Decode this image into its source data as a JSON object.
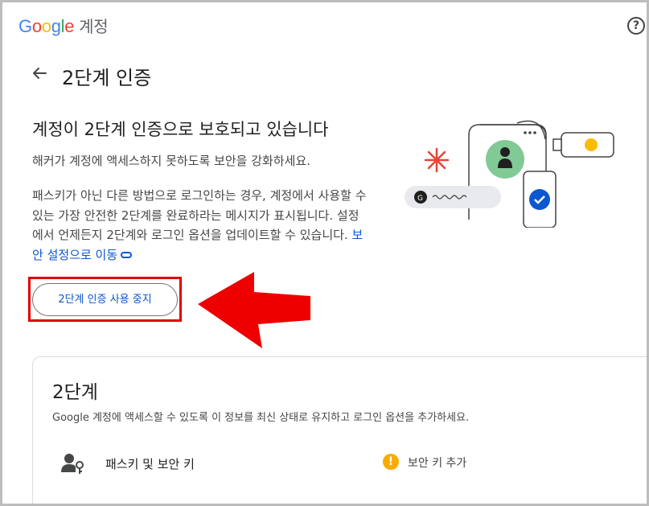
{
  "header": {
    "brand": {
      "g1": "G",
      "o1": "o",
      "o2": "o",
      "g2": "g",
      "l": "l",
      "e": "e",
      "account": "계정"
    },
    "help_icon": "?"
  },
  "page": {
    "title": "2단계 인증",
    "headline": "계정이 2단계 인증으로 보호되고 있습니다",
    "subtext": "해커가 계정에 액세스하지 못하도록 보안을 강화하세요.",
    "paragraph": "패스키가 아닌 다른 방법으로 로그인하는 경우, 계정에서 사용할 수 있는 가장 안전한 2단계를 완료하라는 메시지가 표시됩니다. 설정에서 언제든지 2단계와 로그인 옵션을 업데이트할 수 있습니다.",
    "security_link": "보안 설정으로 이동",
    "stop_button": "2단계 인증 사용 중지"
  },
  "card": {
    "title": "2단계",
    "description": "Google 계정에 액세스할 수 있도록 이 정보를 최신 상태로 유지하고 로그인 옵션을 추가하세요.",
    "passkey_label": "패스키 및 보안 키",
    "warning_icon": "!",
    "add_key_label": "보안 키 추가"
  },
  "colors": {
    "accent": "#0b57d0",
    "highlight_red": "#e00000",
    "warning": "#f9ab00"
  }
}
